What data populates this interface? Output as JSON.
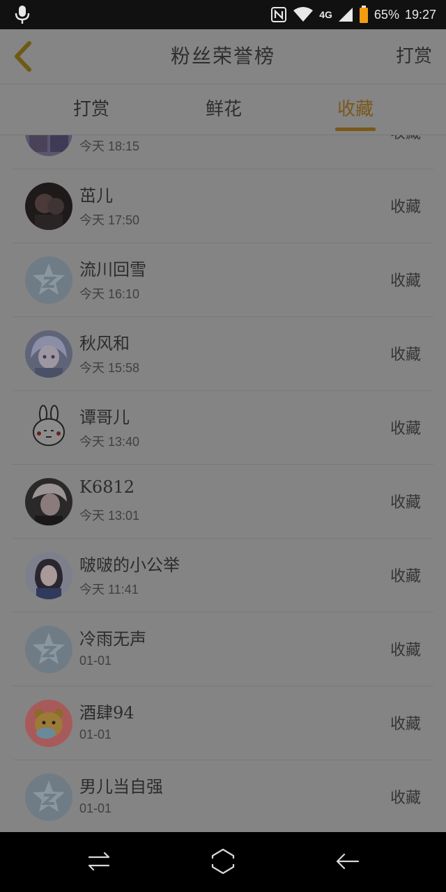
{
  "status_bar": {
    "network": "4G",
    "battery": "65%",
    "time": "19:27"
  },
  "header": {
    "title": "粉丝荣誉榜",
    "right_action": "打赏"
  },
  "tabs": [
    {
      "label": "打赏",
      "active": false
    },
    {
      "label": "鲜花",
      "active": false
    },
    {
      "label": "收藏",
      "active": true
    }
  ],
  "accent_color": "#7a5818",
  "list": [
    {
      "name": "",
      "time": "今天 18:15",
      "action": "收藏",
      "avatar": "photo-avatar-group"
    },
    {
      "name": "茁儿",
      "time": "今天 17:50",
      "action": "收藏",
      "avatar": "photo-avatar-dark"
    },
    {
      "name": "流川回雪",
      "time": "今天 16:10",
      "action": "收藏",
      "avatar": "default-qzone-avatar"
    },
    {
      "name": "秋风和",
      "time": "今天 15:58",
      "action": "收藏",
      "avatar": "anime-avatar"
    },
    {
      "name": "谭哥儿",
      "time": "今天 13:40",
      "action": "收藏",
      "avatar": "bunny-avatar"
    },
    {
      "name": "K6812",
      "time": "今天 13:01",
      "action": "收藏",
      "avatar": "photo-avatar-boy"
    },
    {
      "name": "啵啵的小公举",
      "time": "今天 11:41",
      "action": "收藏",
      "avatar": "photo-avatar-girl"
    },
    {
      "name": "冷雨无声",
      "time": "01-01",
      "action": "收藏",
      "avatar": "default-qzone-avatar"
    },
    {
      "name": "酒肆94",
      "time": "01-01",
      "action": "收藏",
      "avatar": "cartoon-bear-avatar"
    },
    {
      "name": "男儿当自强",
      "time": "01-01",
      "action": "收藏",
      "avatar": "default-qzone-avatar"
    }
  ]
}
